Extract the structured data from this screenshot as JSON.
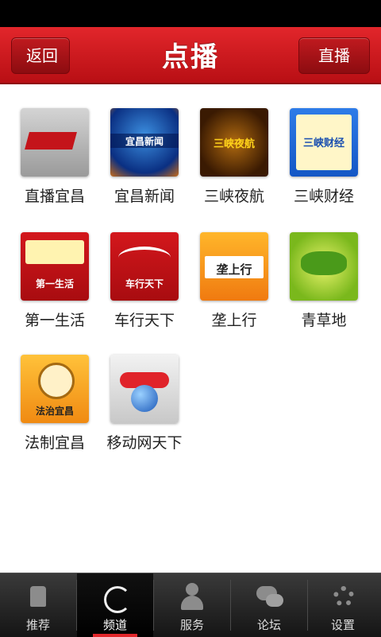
{
  "header": {
    "title": "点播",
    "back_label": "返回",
    "live_label": "直播"
  },
  "channels": [
    {
      "label": "直播宜昌",
      "tile_text": ""
    },
    {
      "label": "宜昌新闻",
      "tile_text": "宜昌新闻"
    },
    {
      "label": "三峡夜航",
      "tile_text": "三峡夜航"
    },
    {
      "label": "三峡财经",
      "tile_text": "三峡财经"
    },
    {
      "label": "第一生活",
      "tile_text": "第一生活"
    },
    {
      "label": "车行天下",
      "tile_text": "车行天下"
    },
    {
      "label": "垄上行",
      "tile_text": "垄上行"
    },
    {
      "label": "青草地",
      "tile_text": ""
    },
    {
      "label": "法制宜昌",
      "tile_text": "法治宜昌"
    },
    {
      "label": "移动网天下",
      "tile_text": ""
    }
  ],
  "tabbar": [
    {
      "label": "推荐",
      "icon": "thumbs-up-icon",
      "active": false
    },
    {
      "label": "频道",
      "icon": "satellite-dish-icon",
      "active": true
    },
    {
      "label": "服务",
      "icon": "person-icon",
      "active": false
    },
    {
      "label": "论坛",
      "icon": "chat-bubbles-icon",
      "active": false
    },
    {
      "label": "设置",
      "icon": "gear-icon",
      "active": false
    }
  ],
  "colors": {
    "header_red": "#d01a1f",
    "tab_active_indicator": "#e1262b",
    "tab_bar": "#262626"
  }
}
